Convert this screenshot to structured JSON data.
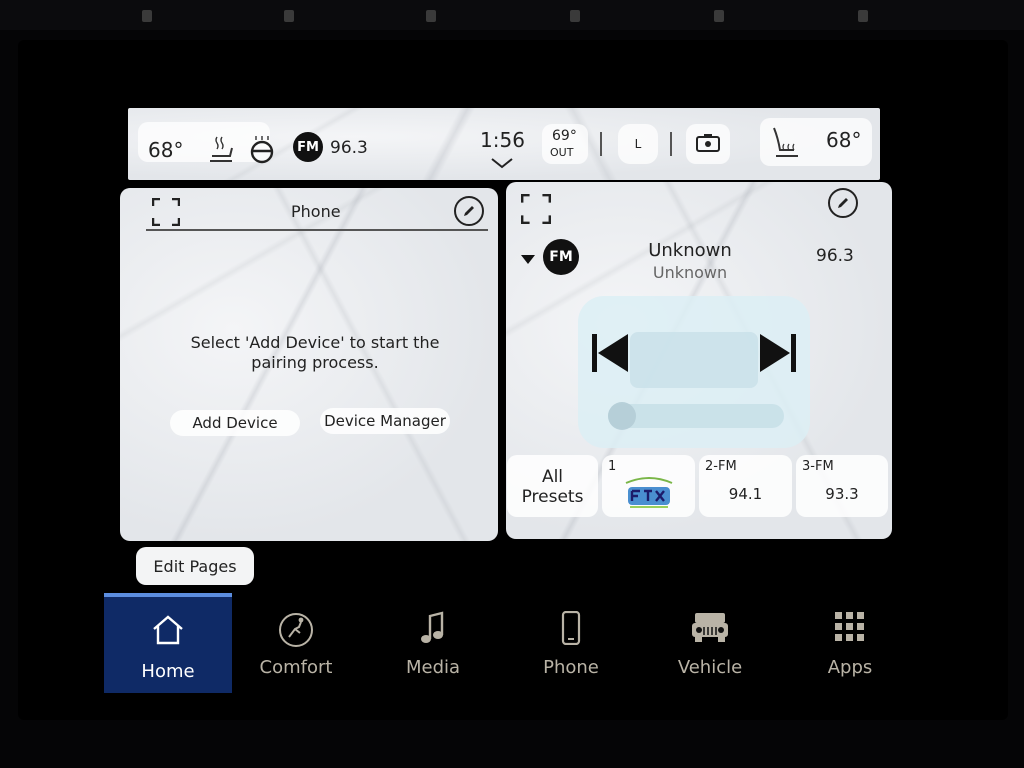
{
  "status_bar": {
    "temp_left": "68°",
    "radio_band": "FM",
    "radio_freq": "96.3",
    "clock": "1:56",
    "outside_temp": "69°",
    "outside_label": "OUT",
    "l_button": "L",
    "temp_right": "68°"
  },
  "phone_card": {
    "title": "Phone",
    "message_line1": "Select 'Add Device' to start the",
    "message_line2": "pairing process.",
    "add_device_label": "Add Device",
    "device_manager_label": "Device Manager"
  },
  "radio_card": {
    "band": "FM",
    "station_name": "Unknown",
    "station_subtitle": "Unknown",
    "frequency": "96.3",
    "presets": [
      {
        "label_line1": "All",
        "label_line2": "Presets"
      },
      {
        "number": "1",
        "freq": "",
        "logo": "station-logo"
      },
      {
        "number": "2-FM",
        "freq": "94.1"
      },
      {
        "number": "3-FM",
        "freq": "93.3"
      }
    ]
  },
  "edit_pages_label": "Edit Pages",
  "nav": [
    {
      "label": "Home",
      "icon": "home-icon",
      "active": true
    },
    {
      "label": "Comfort",
      "icon": "comfort-icon"
    },
    {
      "label": "Media",
      "icon": "music-note-icon"
    },
    {
      "label": "Phone",
      "icon": "phone-icon"
    },
    {
      "label": "Vehicle",
      "icon": "vehicle-icon"
    },
    {
      "label": "Apps",
      "icon": "apps-grid-icon"
    }
  ],
  "colors": {
    "nav_active_bg": "#0f2a66",
    "nav_active_accent": "#5c8ee0",
    "nav_label": "#b9b3a6"
  }
}
